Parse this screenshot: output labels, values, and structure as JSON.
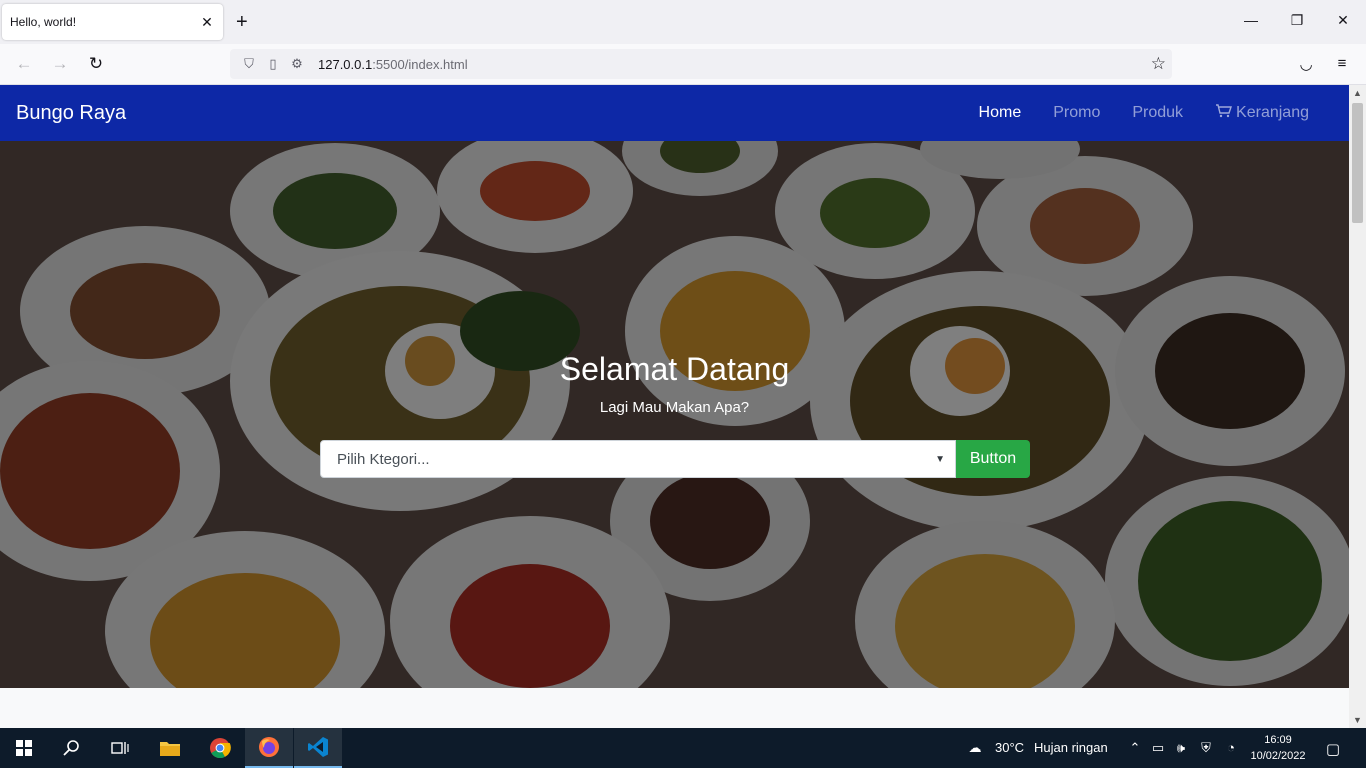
{
  "browser": {
    "tab_title": "Hello, world!",
    "url_host": "127.0.0.1",
    "url_rest": ":5500/index.html"
  },
  "site": {
    "brand": "Bungo Raya",
    "menu": [
      {
        "label": "Home"
      },
      {
        "label": "Promo"
      },
      {
        "label": "Produk"
      },
      {
        "label": "Keranjang"
      }
    ]
  },
  "hero": {
    "title": "Selamat Datang",
    "subtitle": "Lagi Mau Makan Apa?",
    "select_placeholder": "Pilih Ktegori...",
    "button_label": "Button"
  },
  "taskbar": {
    "weather_temp": "30°C",
    "weather_desc": "Hujan ringan",
    "time": "16:09",
    "date": "10/02/2022"
  },
  "colors": {
    "navbar": "#0d28a6",
    "button": "#28a745"
  }
}
